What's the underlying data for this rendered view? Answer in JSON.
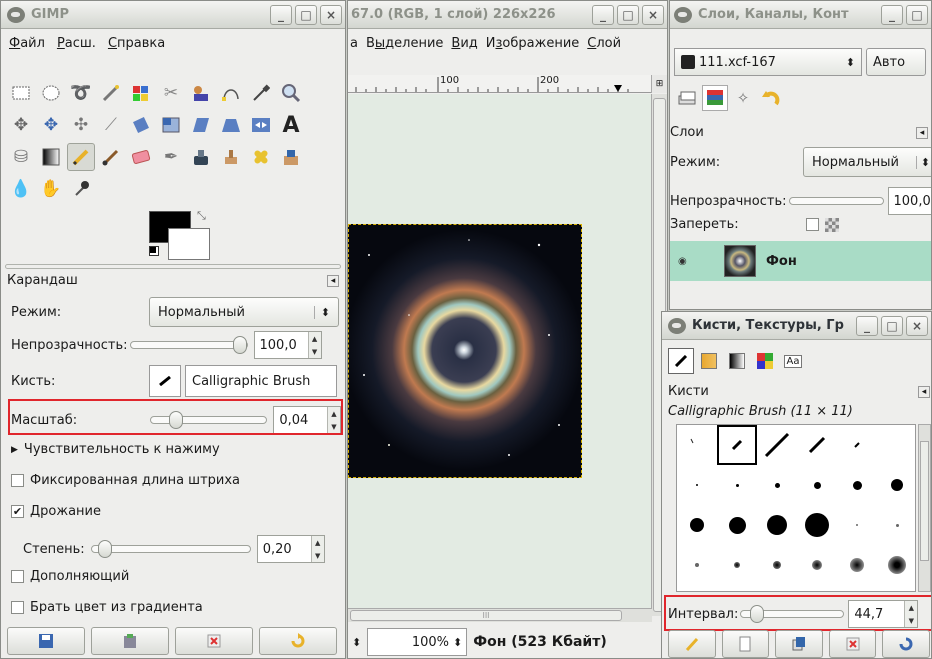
{
  "toolbox": {
    "title": "GIMP",
    "menu": [
      {
        "label": "Файл",
        "u": "Ф",
        "rest": "айл"
      },
      {
        "label": "Расш.",
        "u": "Р",
        "rest": "асш."
      },
      {
        "label": "Справка",
        "u": "С",
        "rest": "правка"
      }
    ],
    "tool_options_title": "Карандаш",
    "mode_label": "Режим:",
    "mode_value": "Нормальный",
    "opacity_label": "Непрозрачность:",
    "opacity_value": "100,0",
    "brush_label": "Кисть:",
    "brush_value": "Calligraphic Brush",
    "scale_label": "Масштаб:",
    "scale_value": "0,04",
    "pressure_label": "Чувствительность к нажиму",
    "fixed_stroke_label": "Фиксированная длина штриха",
    "jitter_label": "Дрожание",
    "jitter_checked": true,
    "amount_label": "Степень:",
    "amount_value": "0,20",
    "incremental_label": "Дополняющий",
    "gradient_label": "Брать цвет из градиента",
    "highlight_color": "#e0262c"
  },
  "image_window": {
    "title": "67.0 (RGB, 1 слой) 226x226",
    "menu": [
      {
        "label": "а",
        "u": "",
        "rest": "а"
      },
      {
        "label": "Выделение",
        "u": "ы",
        "pre": "В",
        "rest": "деление"
      },
      {
        "label": "Вид",
        "u": "В",
        "pre": "",
        "rest": "ид"
      },
      {
        "label": "Изображение",
        "u": "з",
        "pre": "И",
        "rest": "ображение"
      },
      {
        "label": "Слой",
        "u": "С",
        "pre": "",
        "rest": "лой"
      }
    ],
    "ruler_100": "100",
    "ruler_200": "200",
    "zoom": "100%",
    "status": "Фон (523 Кбайт)",
    "scroll_mark": "III"
  },
  "layers_dock": {
    "title": "Слои, Каналы, Конт",
    "image_select": "111.xcf-167",
    "auto_button": "Авто",
    "section": "Слои",
    "mode_label": "Режим:",
    "mode_value": "Нормальный",
    "opacity_label": "Непрозрачность:",
    "opacity_value": "100,0",
    "lock_label": "Запереть:",
    "layer_name": "Фон"
  },
  "brushes_dock": {
    "title": "Кисти, Текстуры, Гр",
    "section": "Кисти",
    "brush_name": "Calligraphic Brush (11 × 11)",
    "spacing_label": "Интервал:",
    "spacing_value": "44,7",
    "spacing_fraction": 0.1,
    "text_tab": "Aa"
  },
  "icons": {
    "minimize": "_",
    "maximize": "□",
    "close": "×",
    "up": "▲",
    "down": "▼",
    "spin_both": "⬍"
  }
}
